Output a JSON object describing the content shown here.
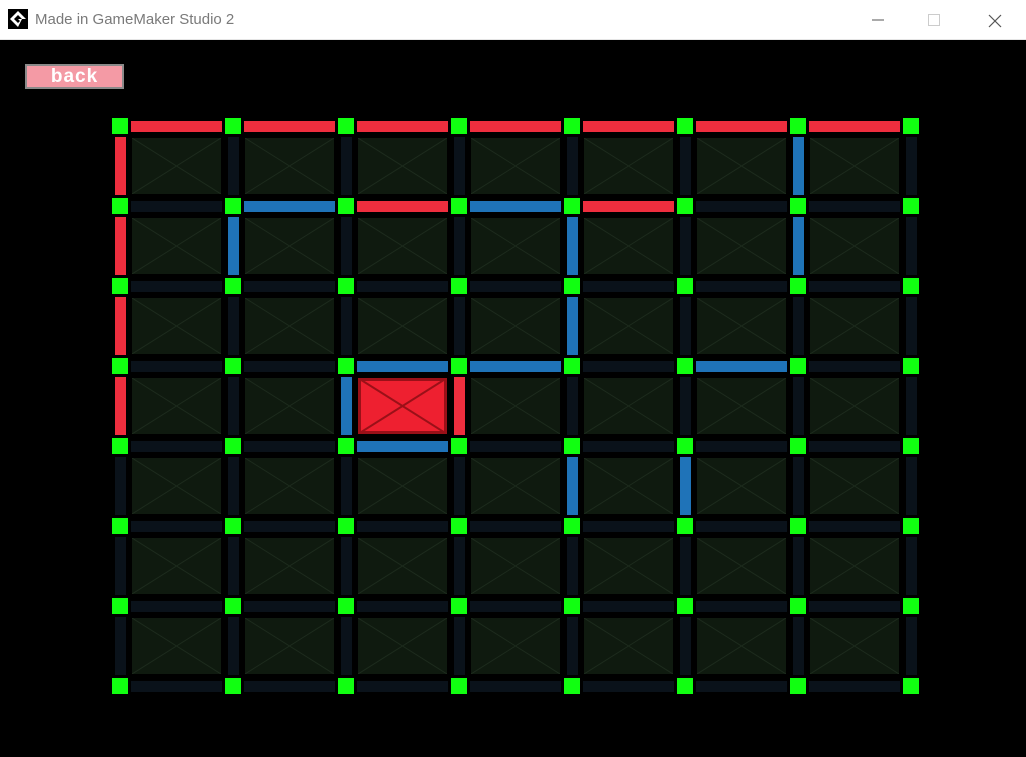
{
  "window": {
    "title": "Made in GameMaker Studio 2",
    "icon": "gamemaker-icon",
    "controls": [
      "minimize-icon",
      "maximize-icon",
      "close-icon"
    ]
  },
  "back_button": {
    "label": "back"
  },
  "board": {
    "columns": 7,
    "rows": 7,
    "colors": {
      "background": "#000000",
      "cell": "#0f1a0f",
      "cell_x": "#1d2b1d",
      "edge_empty": "#0a121a",
      "edge_player_red": "#ee2e3e",
      "edge_player_blue": "#1f73b8",
      "dot": "#11ff11",
      "captured_red": "#ee2030",
      "captured_red_border": "#9a1018"
    },
    "horizontal_edges": [
      [
        "R",
        "R",
        "R",
        "R",
        "R",
        "R",
        "R"
      ],
      [
        "0",
        "B",
        "R",
        "B",
        "R",
        "0",
        "0"
      ],
      [
        "0",
        "0",
        "0",
        "0",
        "0",
        "0",
        "0"
      ],
      [
        "0",
        "0",
        "B",
        "B",
        "0",
        "B",
        "0"
      ],
      [
        "0",
        "0",
        "B",
        "0",
        "0",
        "0",
        "0"
      ],
      [
        "0",
        "0",
        "0",
        "0",
        "0",
        "0",
        "0"
      ],
      [
        "0",
        "0",
        "0",
        "0",
        "0",
        "0",
        "0"
      ],
      [
        "0",
        "0",
        "0",
        "0",
        "0",
        "0",
        "0"
      ]
    ],
    "vertical_edges": [
      [
        "R",
        "0",
        "0",
        "0",
        "0",
        "0",
        "B",
        "0"
      ],
      [
        "R",
        "B",
        "0",
        "0",
        "B",
        "0",
        "B",
        "0"
      ],
      [
        "R",
        "0",
        "0",
        "0",
        "B",
        "0",
        "0",
        "0"
      ],
      [
        "R",
        "0",
        "B",
        "R",
        "0",
        "0",
        "0",
        "0"
      ],
      [
        "0",
        "0",
        "0",
        "0",
        "B",
        "B",
        "0",
        "0"
      ],
      [
        "0",
        "0",
        "0",
        "0",
        "0",
        "0",
        "0",
        "0"
      ],
      [
        "0",
        "0",
        "0",
        "0",
        "0",
        "0",
        "0",
        "0"
      ]
    ],
    "captured_cells": [
      {
        "row": 3,
        "col": 2,
        "owner": "R"
      }
    ]
  }
}
